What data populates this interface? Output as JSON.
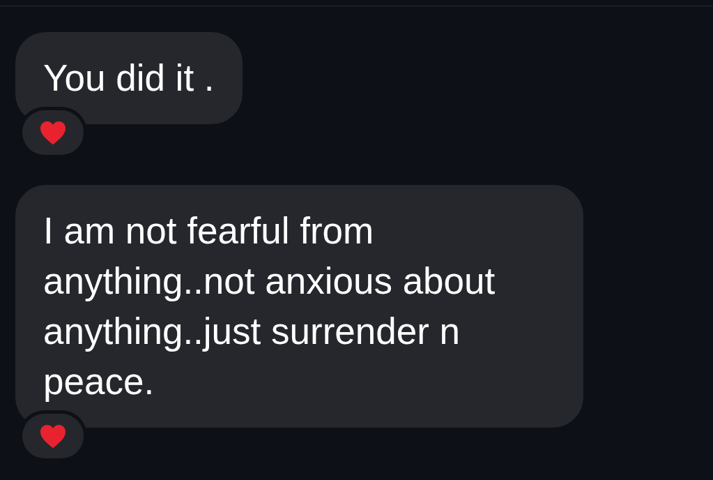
{
  "messages": [
    {
      "text": "You did it .",
      "heart_reaction": true
    },
    {
      "text": "I am not fearful from anything..not anxious about anything..just surrender n peace.",
      "heart_reaction": true
    }
  ]
}
